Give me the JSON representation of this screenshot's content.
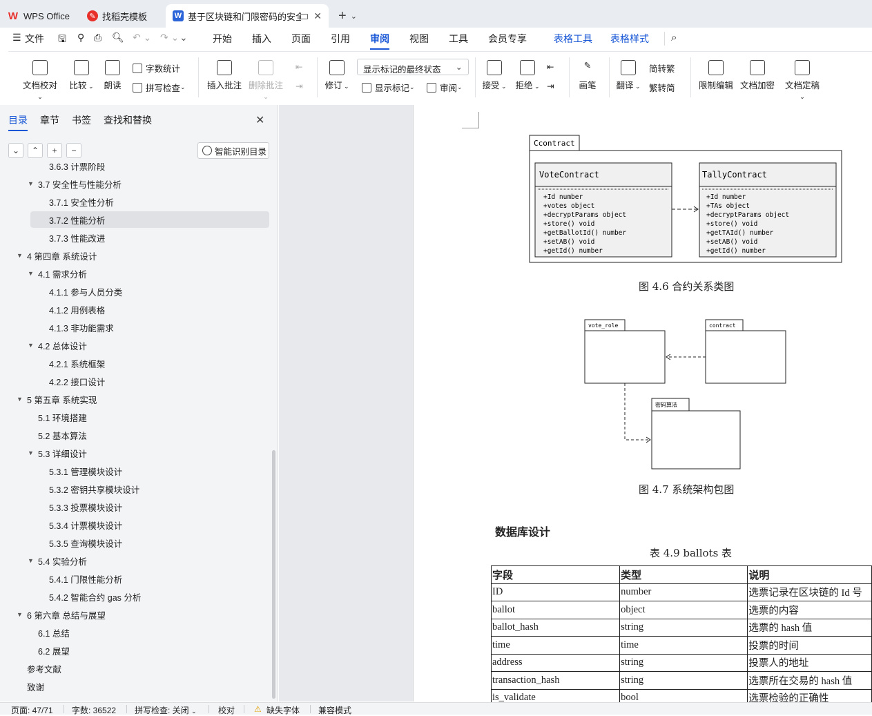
{
  "tabs": {
    "wps": "WPS Office",
    "templates": "找稻壳模板",
    "doc": "基于区块链和门限密码的安全"
  },
  "menu": {
    "file": "文件",
    "items": [
      "开始",
      "插入",
      "页面",
      "引用",
      "审阅",
      "视图",
      "工具",
      "会员专享"
    ],
    "table_tools": "表格工具",
    "table_style": "表格样式"
  },
  "toolbar": {
    "proofread": "文档校对",
    "compare": "比较",
    "read_aloud": "朗读",
    "word_count": "字数统计",
    "spell_check": "拼写检查",
    "insert_comment": "插入批注",
    "delete_comment": "删除批注",
    "revise": "修订",
    "markup_state": "显示标记的最终状态",
    "show_markup": "显示标记",
    "review": "审阅",
    "accept": "接受",
    "reject": "拒绝",
    "ink": "画笔",
    "translate": "翻译",
    "to_traditional": "简转繁",
    "to_simplified": "繁转简",
    "restrict_edit": "限制编辑",
    "encrypt": "文档加密",
    "finalize": "文档定稿"
  },
  "panel": {
    "tabs": [
      "目录",
      "章节",
      "书签",
      "查找和替换"
    ],
    "smart_toc": "智能识别目录",
    "toc": [
      {
        "label": "3.6.3  计票阶段",
        "level": 3,
        "arrow": ""
      },
      {
        "label": "3.7  安全性与性能分析",
        "level": 2,
        "arrow": "▼"
      },
      {
        "label": "3.7.1  安全性分析",
        "level": 3,
        "arrow": ""
      },
      {
        "label": "3.7.2  性能分析",
        "level": 3,
        "arrow": "",
        "selected": true
      },
      {
        "label": "3.7.3  性能改进",
        "level": 3,
        "arrow": ""
      },
      {
        "label": "4  第四章    系统设计",
        "level": 1,
        "arrow": "▼"
      },
      {
        "label": "4.1  需求分析",
        "level": 2,
        "arrow": "▼"
      },
      {
        "label": "4.1.1  参与人员分类",
        "level": 3,
        "arrow": ""
      },
      {
        "label": "4.1.2  用例表格",
        "level": 3,
        "arrow": ""
      },
      {
        "label": "4.1.3  非功能需求",
        "level": 3,
        "arrow": ""
      },
      {
        "label": "4.2  总体设计",
        "level": 2,
        "arrow": "▼"
      },
      {
        "label": "4.2.1  系统框架",
        "level": 3,
        "arrow": ""
      },
      {
        "label": "4.2.2  接口设计",
        "level": 3,
        "arrow": ""
      },
      {
        "label": "5  第五章    系统实现",
        "level": 1,
        "arrow": "▼"
      },
      {
        "label": "5.1  环境搭建",
        "level": 2,
        "arrow": ""
      },
      {
        "label": "5.2  基本算法",
        "level": 2,
        "arrow": ""
      },
      {
        "label": "5.3  详细设计",
        "level": 2,
        "arrow": "▼"
      },
      {
        "label": "5.3.1  管理模块设计",
        "level": 3,
        "arrow": ""
      },
      {
        "label": "5.3.2  密钥共享模块设计",
        "level": 3,
        "arrow": ""
      },
      {
        "label": "5.3.3  投票模块设计",
        "level": 3,
        "arrow": ""
      },
      {
        "label": "5.3.4  计票模块设计",
        "level": 3,
        "arrow": ""
      },
      {
        "label": "5.3.5  查询模块设计",
        "level": 3,
        "arrow": ""
      },
      {
        "label": "5.4  实验分析",
        "level": 2,
        "arrow": "▼"
      },
      {
        "label": "5.4.1  门限性能分析",
        "level": 3,
        "arrow": ""
      },
      {
        "label": "5.4.2  智能合约 gas 分析",
        "level": 3,
        "arrow": ""
      },
      {
        "label": "6  第六章    总结与展望",
        "level": 1,
        "arrow": "▼"
      },
      {
        "label": "6.1  总结",
        "level": 2,
        "arrow": ""
      },
      {
        "label": "6.2  展望",
        "level": 2,
        "arrow": ""
      },
      {
        "label": "参考文献",
        "level": 1,
        "arrow": ""
      },
      {
        "label": "致谢",
        "level": 1,
        "arrow": ""
      }
    ]
  },
  "doc": {
    "diagram1": {
      "package": "Ccontract",
      "vote": {
        "name": "VoteContract",
        "members": [
          "+Id number",
          "+votes object",
          "+decryptParams object",
          "+store() void",
          "+getBallotId() number",
          "+setAB()  void",
          "+getId()  number"
        ]
      },
      "tally": {
        "name": "TallyContract",
        "members": [
          "+Id number",
          "+TAs object",
          "+decryptParams object",
          "+store() void",
          "+getTAId() number",
          "+setAB()  void",
          "+getId()  number"
        ]
      }
    },
    "caption1": "图 4.6 合约关系类图",
    "diagram2": {
      "pkg1": "vote_role",
      "pkg2": "contract",
      "pkg3": "密码算法"
    },
    "caption2": "图 4.7 系统架构包图",
    "section_title": "数据库设计",
    "table_caption": "表 4.9 ballots 表",
    "table": [
      [
        "字段",
        "类型",
        "说明"
      ],
      [
        "ID",
        "number",
        "选票记录在区块链的 Id 号"
      ],
      [
        "ballot",
        "object",
        "选票的内容"
      ],
      [
        "ballot_hash",
        "string",
        "选票的 hash 值"
      ],
      [
        "time",
        "time",
        "投票的时间"
      ],
      [
        "address",
        "string",
        "投票人的地址"
      ],
      [
        "transaction_hash",
        "string",
        "选票所在交易的 hash 值"
      ],
      [
        "is_validate",
        "bool",
        "选票检验的正确性"
      ]
    ]
  },
  "status": {
    "page": "页面: 47/71",
    "words": "字数: 36522",
    "spell": "拼写检查: 关闭",
    "proof": "校对",
    "missing_font": "缺失字体",
    "compat": "兼容模式"
  }
}
